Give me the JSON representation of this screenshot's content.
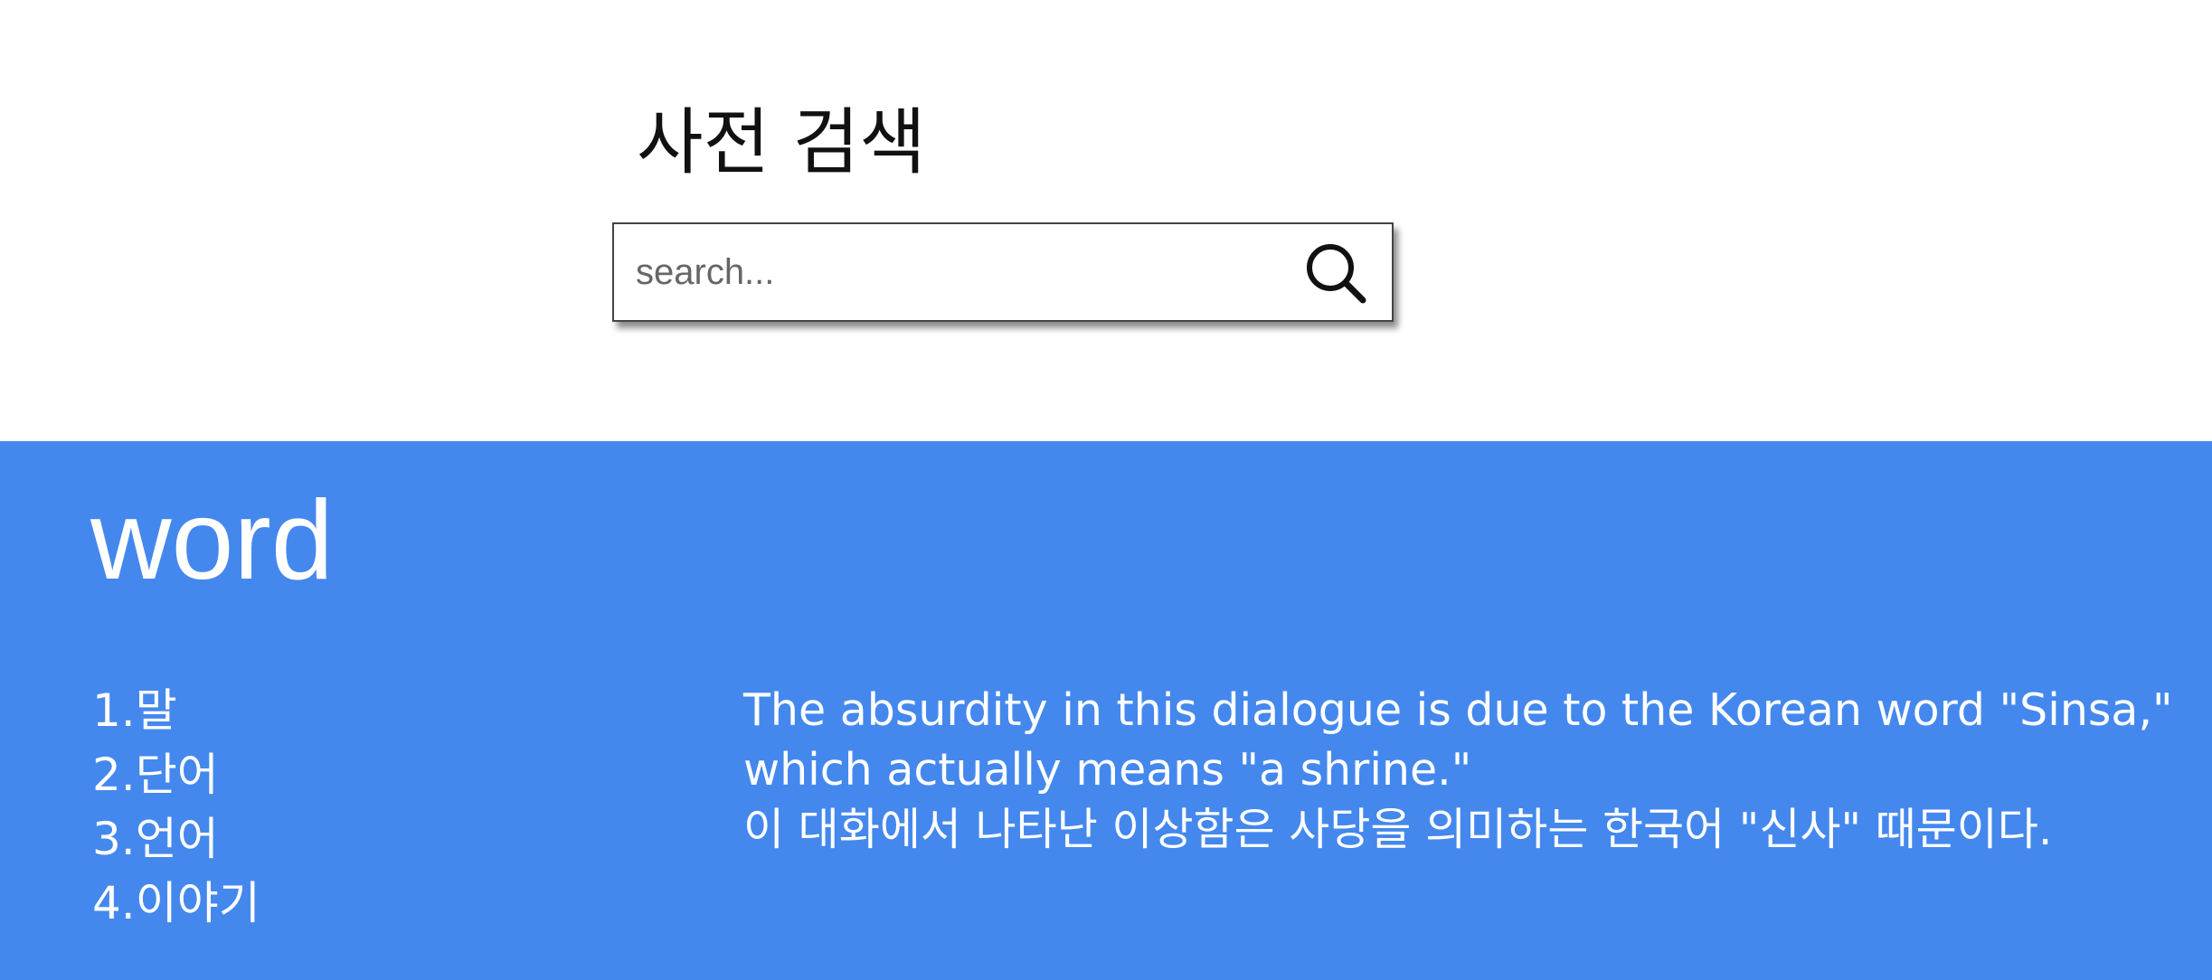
{
  "header": {
    "title": "사전 검색"
  },
  "search": {
    "placeholder": "search...",
    "value": "",
    "icon": "search-icon"
  },
  "result": {
    "word": "word",
    "meanings": [
      "1.말",
      "2.단어",
      "3.언어",
      "4.이야기"
    ],
    "explanation": [
      "The absurdity in this dialogue is due to the Korean word \"Sinsa,\"",
      "which actually means \"a shrine.\"",
      "이 대화에서 나타난 이상함은 사당을 의미하는 한국어 \"신사\" 때문이다."
    ]
  },
  "colors": {
    "result_background": "#4488ee",
    "page_background": "#ffffff",
    "text_on_result": "#ffffff"
  }
}
